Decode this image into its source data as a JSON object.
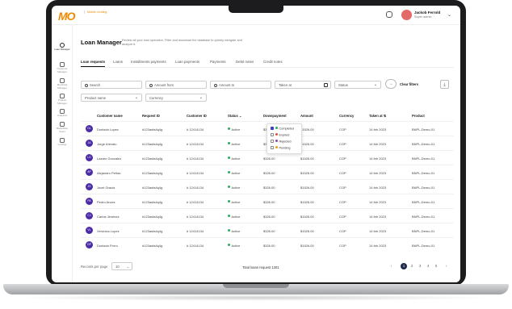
{
  "app": {
    "logo": "MO",
    "logo_sub": "Mobile Lending"
  },
  "user": {
    "name": "Jackob Ferrold",
    "role": "Super admin"
  },
  "sidebar": {
    "items": [
      {
        "label": "Loan Manager",
        "icon": "dollar-circle-icon",
        "active": true
      },
      {
        "label": "Customer Manager",
        "icon": "users-icon"
      },
      {
        "label": "Merchant Manager",
        "icon": "store-icon"
      },
      {
        "label": "Product Manager",
        "icon": "box-icon"
      },
      {
        "label": "Analytics",
        "icon": "chart-icon"
      },
      {
        "label": "Backoffice Users",
        "icon": "user-icon"
      },
      {
        "label": "Lending",
        "icon": "document-icon"
      }
    ]
  },
  "page": {
    "title": "Loan Manager",
    "description": "Review all your loan operation. Filter and download the database to quickly navigate and analyze it."
  },
  "tabs": [
    "Loan requests",
    "Loans",
    "Installments payments",
    "Loan payments",
    "Payments",
    "Debit notes",
    "Credit notes"
  ],
  "filters": {
    "search_placeholder": "Search",
    "amount_from_placeholder": "Amount from",
    "amount_to_placeholder": "Amount to",
    "taken_at_placeholder": "Taken at",
    "status_placeholder": "Status",
    "product_name_placeholder": "Product name",
    "currency_placeholder": "Currency",
    "clear_label": "Clear filters"
  },
  "table": {
    "headers": [
      "Customer name",
      "Request ID",
      "Customer ID",
      "Status",
      "Downpayment",
      "Amount",
      "Currency",
      "Taken at",
      "Product"
    ],
    "rows": [
      {
        "initials": "DL",
        "name": "Donlado Lopez",
        "request_id": "#123asfa4q4g",
        "customer_id": "# 12414134",
        "status": "Active",
        "down": "$326.00",
        "amount": "$1526.00",
        "currency": "COP",
        "taken": "14 feb 2023",
        "product": "BNPL-Demo-01"
      },
      {
        "initials": "JA",
        "name": "Jorge Arevalo",
        "request_id": "#123asfa4q4g",
        "customer_id": "# 12414134",
        "status": "Active",
        "down": "$326.00",
        "amount": "$1526.00",
        "currency": "COP",
        "taken": "14 feb 2023",
        "product": "BNPL-Demo-01"
      },
      {
        "initials": "LG",
        "name": "Lazaro Gonzalez",
        "request_id": "#123asfa4q4g",
        "customer_id": "# 12414134",
        "status": "Active",
        "down": "$326.00",
        "amount": "$1526.00",
        "currency": "COP",
        "taken": "14 feb 2023",
        "product": "BNPL-Demo-01"
      },
      {
        "initials": "AP",
        "name": "Alejandro Peñas",
        "request_id": "#123asfa4q4g",
        "customer_id": "# 12414134",
        "status": "Active",
        "down": "$326.00",
        "amount": "$1526.00",
        "currency": "COP",
        "taken": "14 feb 2023",
        "product": "BNPL-Demo-01"
      },
      {
        "initials": "JG",
        "name": "Jucel Gracia",
        "request_id": "#123asfa4q4g",
        "customer_id": "# 12414134",
        "status": "Active",
        "down": "$326.00",
        "amount": "$1526.00",
        "currency": "COP",
        "taken": "14 feb 2023",
        "product": "BNPL-Demo-01"
      },
      {
        "initials": "PA",
        "name": "Pedro Anzez",
        "request_id": "#123asfa4q4g",
        "customer_id": "# 12414134",
        "status": "Active",
        "down": "$326.00",
        "amount": "$1526.00",
        "currency": "COP",
        "taken": "14 feb 2023",
        "product": "BNPL-Demo-01"
      },
      {
        "initials": "CJ",
        "name": "Carlos Jiménez",
        "request_id": "#123asfa4q4g",
        "customer_id": "# 12414134",
        "status": "Active",
        "down": "$326.00",
        "amount": "$1526.00",
        "currency": "COP",
        "taken": "14 feb 2023",
        "product": "BNPL-Demo-01"
      },
      {
        "initials": "VL",
        "name": "Verónica Lopez",
        "request_id": "#123asfa4q4g",
        "customer_id": "# 12414134",
        "status": "Active",
        "down": "$326.00",
        "amount": "$1526.00",
        "currency": "COP",
        "taken": "14 feb 2023",
        "product": "BNPL-Demo-01"
      },
      {
        "initials": "DP",
        "name": "Donlado Porro",
        "request_id": "#123asfa4q4g",
        "customer_id": "# 12414134",
        "status": "Active",
        "down": "$326.00",
        "amount": "$1526.00",
        "currency": "COP",
        "taken": "14 feb 2023",
        "product": "BNPL-Demo-01"
      }
    ]
  },
  "status_dropdown": {
    "options": [
      {
        "label": "Completed",
        "checked": true,
        "color": "#27ae60"
      },
      {
        "label": "Expired",
        "checked": false,
        "color": "#e74c3c"
      },
      {
        "label": "Rejected",
        "checked": false,
        "color": "#8e44ad"
      },
      {
        "label": "Pending",
        "checked": false,
        "color": "#f39c12"
      }
    ]
  },
  "footer": {
    "records_label": "Records per page",
    "records_value": "10",
    "total_label": "Total loans request 1301",
    "pages": [
      "1",
      "2",
      "3",
      "4",
      "5"
    ],
    "current_page": "1"
  },
  "colors": {
    "brand_orange": "#f08a00",
    "brand_red": "#e30613",
    "avatar": "#4b2ca6",
    "active_status": "#27ae60"
  }
}
